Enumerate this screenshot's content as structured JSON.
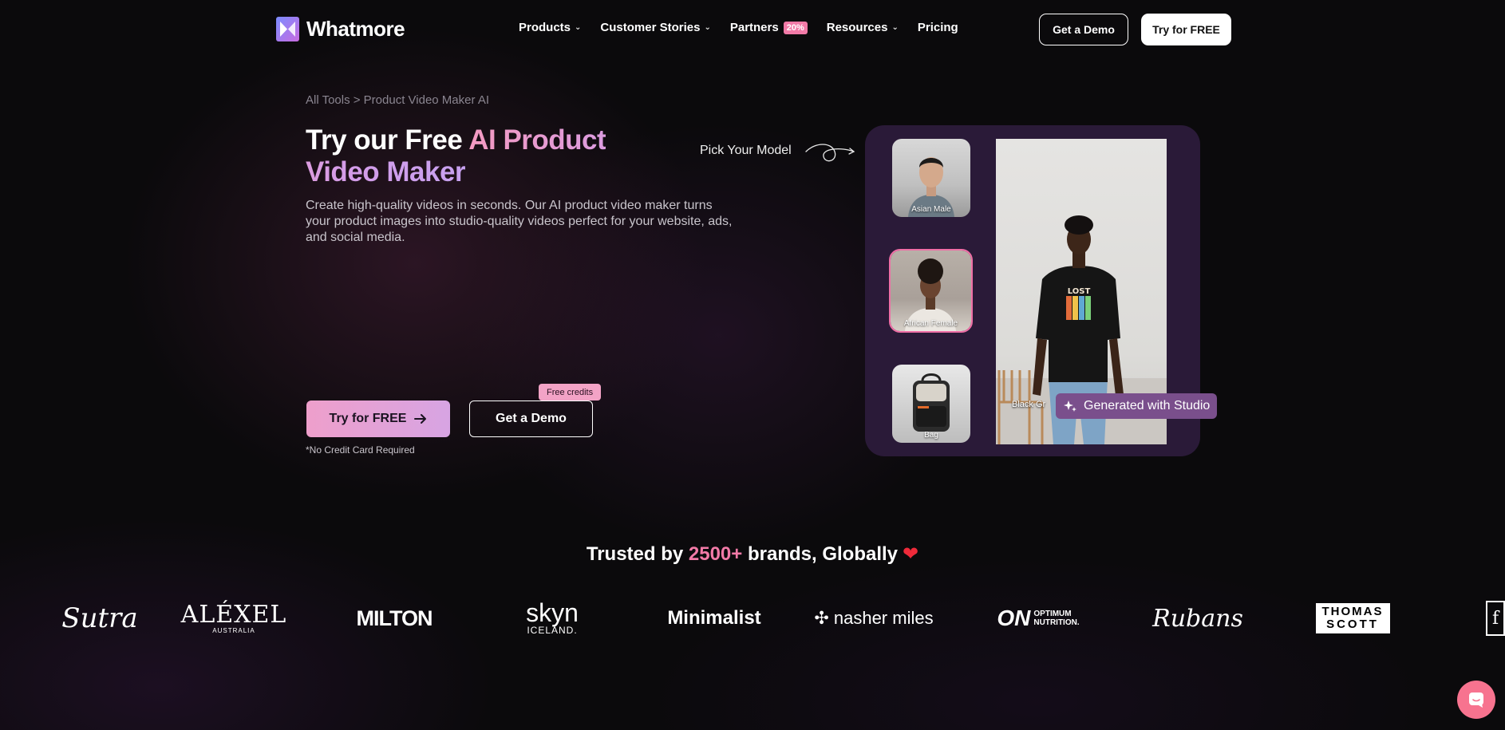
{
  "nav": {
    "logo_text": "Whatmore",
    "items": [
      {
        "label": "Products"
      },
      {
        "label": "Customer Stories"
      },
      {
        "label": "Partners",
        "badge": "20%"
      },
      {
        "label": "Resources"
      },
      {
        "label": "Pricing"
      }
    ],
    "get_demo": "Get a Demo",
    "try_free": "Try for FREE"
  },
  "hero": {
    "breadcrumb": "All Tools > Product Video Maker AI",
    "title_plain": "Try our Free ",
    "title_highlight": "AI Product Video Maker",
    "description": "Create high-quality videos in seconds. Our AI product video maker turns your product images into studio-quality videos perfect for your website, ads, and social media.",
    "try_button": "Try for FREE",
    "demo_button": "Get a Demo",
    "free_credits_badge": "Free credits",
    "no_credit_card": "*No Credit Card Required"
  },
  "model_picker": {
    "prompt": "Pick Your Model",
    "models": [
      {
        "label": "Asian Male"
      },
      {
        "label": "African Female"
      },
      {
        "label": "Bag"
      }
    ],
    "main_label": "Black Gr",
    "generated_badge": "Generated with Studio"
  },
  "trusted": {
    "prefix": "Trusted by ",
    "count": "2500+",
    "suffix": " brands, Globally"
  },
  "brands": [
    "Sutra",
    "ALÉXEL",
    "AUSTRALIA",
    "MILTON",
    "skyn",
    "ICELAND.",
    "Minimalist",
    "nasher miles",
    "ON",
    "OPTIMUM",
    "NUTRITION.",
    "Rubans",
    "THOMAS",
    "SCOTT",
    "f"
  ],
  "colors": {
    "accent_pink": "#f27aa7",
    "accent_purple": "#c7a1f0",
    "panel_bg": "#2a1a38",
    "page_bg": "#0b0a0c"
  }
}
